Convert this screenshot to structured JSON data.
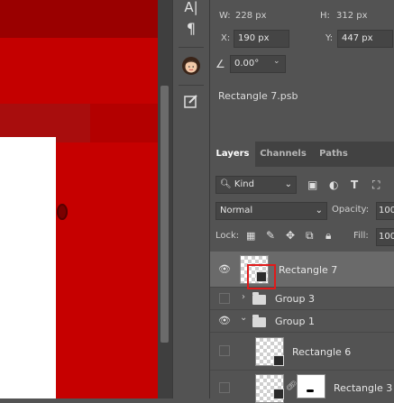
{
  "properties": {
    "w_label": "W:",
    "w_value": "228 px",
    "h_label": "H:",
    "h_value": "312 px",
    "x_label": "X:",
    "x_value": "190 px",
    "y_label": "Y:",
    "y_value": "447 px",
    "angle_value": "0.00°",
    "smart_object_name": "Rectangle 7.psb"
  },
  "tabs": [
    {
      "label": "Layers"
    },
    {
      "label": "Channels"
    },
    {
      "label": "Paths"
    }
  ],
  "layers_panel": {
    "kind_filter": "Kind",
    "blend_mode": "Normal",
    "opacity_label": "Opacity:",
    "opacity_value": "100",
    "lock_label": "Lock:",
    "fill_label": "Fill:",
    "fill_value": "100"
  },
  "layers": [
    {
      "name": "Rectangle 7",
      "visible": true,
      "selected": true
    },
    {
      "name": "Group 3",
      "visible": false,
      "expanded": false
    },
    {
      "name": "Group 1",
      "visible": true,
      "expanded": true
    },
    {
      "name": "Rectangle 6",
      "visible": false
    },
    {
      "name": "Rectangle 3",
      "visible": false
    }
  ],
  "colors": {
    "highlight": "#e01b1b",
    "canvas_red": "#c40000",
    "panel_bg": "#535353"
  }
}
